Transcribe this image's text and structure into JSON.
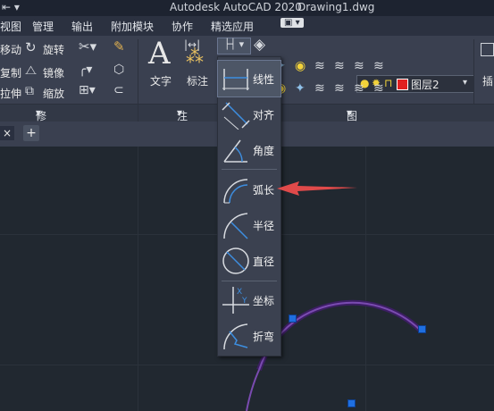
{
  "title": {
    "app": "Autodesk AutoCAD 2020",
    "file": "Drawing1.dwg"
  },
  "menu": [
    "视图",
    "管理",
    "输出",
    "附加模块",
    "协作",
    "精选应用"
  ],
  "ribbon": {
    "modify": {
      "items": [
        "移动",
        "旋转",
        "复制",
        "镜像",
        "拉伸",
        "缩放"
      ],
      "panel_label": "修改"
    },
    "annotation": {
      "text_label": "文字",
      "dimension_label": "标注",
      "panel_label": "注释"
    },
    "layers": {
      "current_layer": "图层2",
      "panel_label": "图层"
    },
    "insert_label": "插"
  },
  "dimension_menu": {
    "items": [
      "线性",
      "对齐",
      "角度",
      "弧长",
      "半径",
      "直径",
      "坐标",
      "折弯"
    ]
  },
  "tabs": {
    "new_tab": "+",
    "close": "×"
  },
  "colors": {
    "accent": "#3d8ee0",
    "arrow": "#e04a4a",
    "arc": "#5a2d88",
    "grip": "#1f6fe0",
    "layer_swatch": "#e02020"
  }
}
